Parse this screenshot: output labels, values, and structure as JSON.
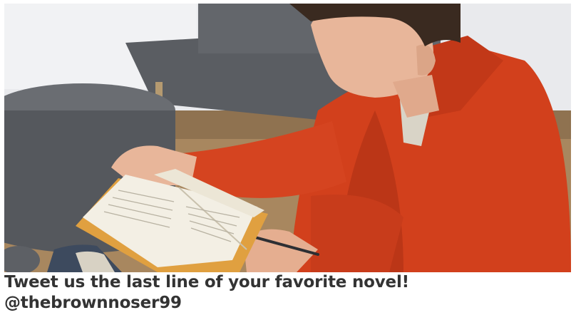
{
  "post": {
    "caption": "Tweet us the last line of your favorite novel!",
    "handle": "@thebrownnoser99"
  },
  "photo": {
    "colors": {
      "wall": "#e9eaed",
      "bench": "#5a5d62",
      "ottoman": "#55585d",
      "floor": "#a8875f",
      "jacket": "#d2401c",
      "jacket_shadow": "#a82d14",
      "skin": "#e8b69a",
      "hair": "#3a2a20",
      "book_page": "#f3efe4",
      "book_edge": "#e0a040"
    }
  }
}
